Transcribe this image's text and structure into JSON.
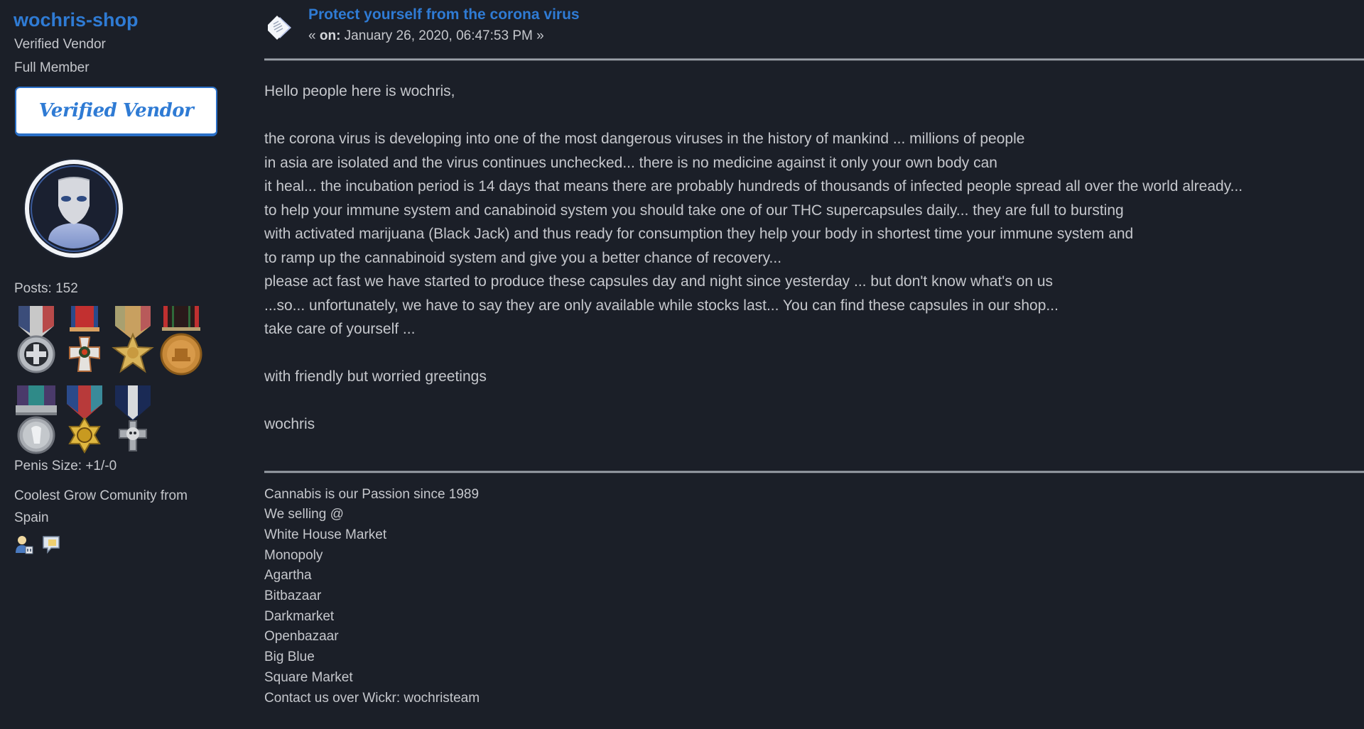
{
  "poster": {
    "name": "wochris-shop",
    "title": "Verified Vendor",
    "rank": "Full Member",
    "badge_label": "Verified Vendor",
    "avatar_icon": "alien-avatar-icon",
    "posts": "Posts: 152",
    "medals": [
      {
        "icon": "medal-tricolor-cross-icon"
      },
      {
        "icon": "medal-red-cross-icon"
      },
      {
        "icon": "medal-gold-star-icon"
      },
      {
        "icon": "medal-bronze-round-icon"
      },
      {
        "icon": "medal-silver-bar-icon"
      },
      {
        "icon": "medal-gold-hexstar-icon"
      },
      {
        "icon": "medal-silver-skull-cross-icon"
      }
    ],
    "karma": "Penis Size: +1/-0",
    "personal_text": "Coolest Grow Comunity from Spain",
    "profile_icons": [
      "profile-icon",
      "personal-message-icon"
    ]
  },
  "post": {
    "topic_icon": "topic-post-icon",
    "subject": "Protect yourself from the corona virus",
    "date_prefix": "« ",
    "date_on": "on:",
    "date_value": " January 26, 2020, 06:47:53 PM »",
    "body_lines": [
      "Hello people here is wochris,",
      "",
      "the corona virus is developing into one of the most dangerous viruses in the history of mankind ... millions of people",
      "in asia are isolated and the virus continues unchecked... there is no medicine against it only your own body can",
      "it heal... the incubation period is 14 days that means there are probably hundreds of thousands of infected people spread all over the world already...",
      "to help your immune system and canabinoid system you should take one of our THC supercapsules daily... they are full to bursting",
      "with activated marijuana (Black Jack) and thus ready for consumption they help your body in shortest time your immune system and",
      "to ramp up the cannabinoid system and give you a better chance of recovery...",
      "please act fast we have started to produce these capsules day and night since yesterday ... but don't know what's on us",
      "...so... unfortunately, we have to say they are only available while stocks last... You can find these capsules in our shop...",
      "take care of yourself ...",
      "",
      "with friendly but worried greetings",
      "",
      "wochris"
    ],
    "signature_lines": [
      "Cannabis is our Passion since 1989",
      "We selling @",
      "White House Market",
      "Monopoly",
      "Agartha",
      "Bitbazaar",
      "Darkmarket",
      "Openbazaar",
      "Big Blue",
      "Square Market",
      "Contact us over Wickr: wochristeam"
    ]
  },
  "colors": {
    "background": "#1b1f28",
    "link": "#2f7bd4",
    "text": "#c5c7cc",
    "badge_border": "#2a6fc7"
  }
}
